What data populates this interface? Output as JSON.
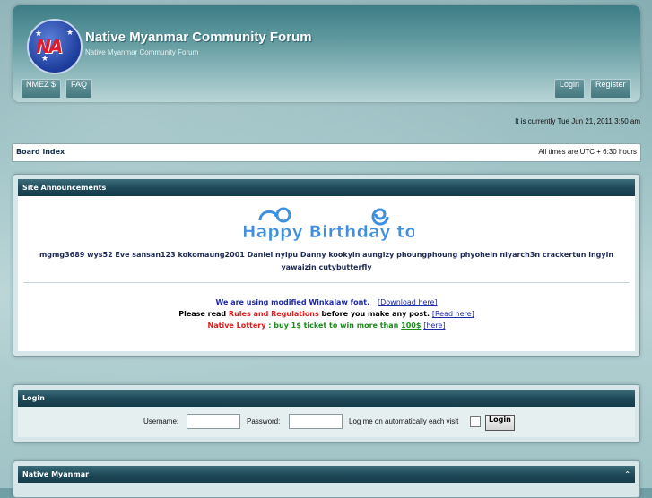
{
  "header": {
    "logo_text": "NA",
    "title": "Native Myanmar Community Forum",
    "description": "Native Myanmar Community Forum"
  },
  "nav": {
    "left": [
      {
        "label": "NMEZ $"
      },
      {
        "label": "FAQ"
      }
    ],
    "right": [
      {
        "label": "Login"
      },
      {
        "label": "Register"
      }
    ]
  },
  "current_time": "It is currently Tue Jun 21, 2011 3:50 am",
  "breadcrumb": {
    "board_index": "Board index",
    "timezone": "All times are UTC + 6:30 hours"
  },
  "announcements": {
    "title": "Site Announcements",
    "birthday_banner": "Happy Birthday to",
    "birthday_line1": "mgmg3689 wys52 Eve sansan123 kokomaung2001 Daniel nyipu Danny kookyin aungizy phoungphoung phyohein niyarch3n crackertun ingyin",
    "birthday_line2": "yawaizin cutybutterfly",
    "font_note": "We are using modified Winkalaw font.",
    "font_download": "[Download here]",
    "rules_prefix": "Please read ",
    "rules_link": "Rules and Regulations",
    "rules_suffix": " before you make any post.",
    "rules_read": "[Read here]",
    "lottery_label": "Native Lottery",
    "lottery_text": " : buy 1$ ticket to win more than ",
    "lottery_amount": "100$",
    "lottery_here": "[here]"
  },
  "login": {
    "title": "Login",
    "username_label": "Username:",
    "password_label": "Password:",
    "remember_label": "Log me on automatically each visit",
    "submit": "Login"
  },
  "category": {
    "title": "Native Myanmar",
    "chevron": "⌃"
  },
  "colors": {
    "header_dark": "#1f4a59",
    "link_blue": "#1d2aa8",
    "alert_red": "#e01b1b",
    "lottery_green": "#1b8c1b",
    "birthday_blue": "#3f8fe0"
  }
}
